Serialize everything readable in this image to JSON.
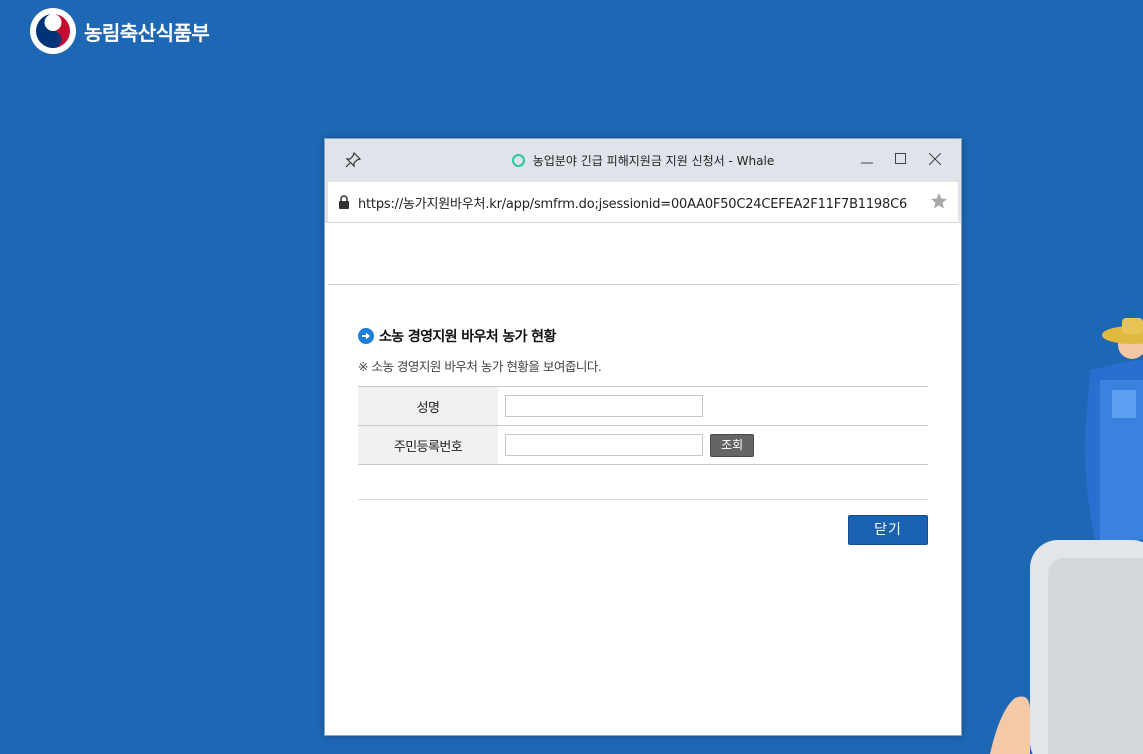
{
  "brand": {
    "name": "농림축산식품부"
  },
  "window": {
    "title": "농업분야 긴급 피해지원금 지원 신청서 - Whale",
    "url": "https://농가지원바우처.kr/app/smfrm.do;jsessionid=00AA0F50C24CEFEA2F11F7B1198C6",
    "controls": {
      "minimize": "—",
      "maximize": "☐",
      "close": "✕"
    }
  },
  "section": {
    "title": "소농 경영지원 바우처 농가 현황",
    "description": "※ 소농 경영지원 바우처 농가 현황을 보여줍니다."
  },
  "form": {
    "fields": [
      {
        "label": "성명",
        "value": ""
      },
      {
        "label": "주민등록번호",
        "value": ""
      }
    ],
    "search_label": "조회"
  },
  "footer": {
    "close_label": "닫기"
  },
  "colors": {
    "background": "#1e67b4",
    "accent": "#1b62b2",
    "whale": "#2fc5a2"
  }
}
